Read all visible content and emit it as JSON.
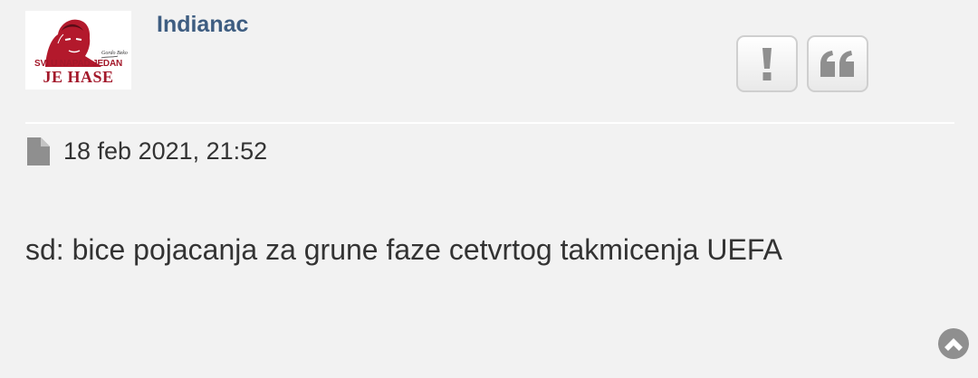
{
  "post": {
    "avatar_caption_top": "SVI U NAPAD JEDAN",
    "avatar_caption_big": "JE HASE",
    "username": "Indianac",
    "date": "18 feb 2021, 21:52",
    "text": "sd: bice pojacanja za grune faze cetvrtog takmicenja UEFA"
  },
  "icons": {
    "report": "exclamation-icon",
    "quote": "quote-icon",
    "post": "document-icon",
    "top": "chevron-up-circle-icon"
  },
  "colors": {
    "background": "#f2f2f2",
    "username": "#3e5d81",
    "text": "#333333",
    "icon": "#8f8f8f"
  }
}
